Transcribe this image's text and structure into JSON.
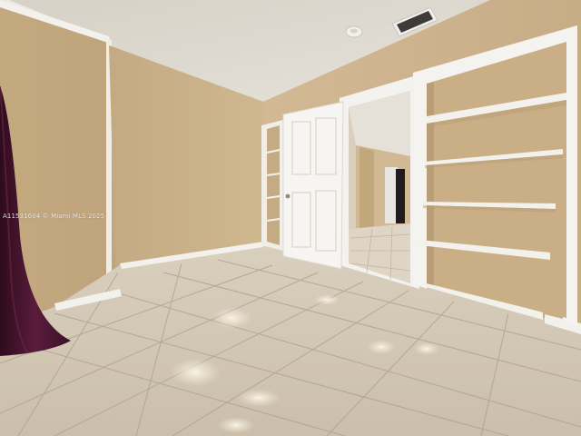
{
  "photo": {
    "watermark": "A11531604 © Miami MLS 2025",
    "subject": "empty-room-with-open-door-and-built-in-shelves"
  },
  "colors": {
    "ceiling": "#ddd8cf",
    "wall_left": "#c6ac86",
    "wall_back": "#c9b189",
    "wall_right": "#cdb48f",
    "floor": "#cfc3b0",
    "grout": "#a89c8a",
    "trim": "#f4f2ee",
    "door": "#f5f4f1",
    "curtain": "#4a1630"
  }
}
